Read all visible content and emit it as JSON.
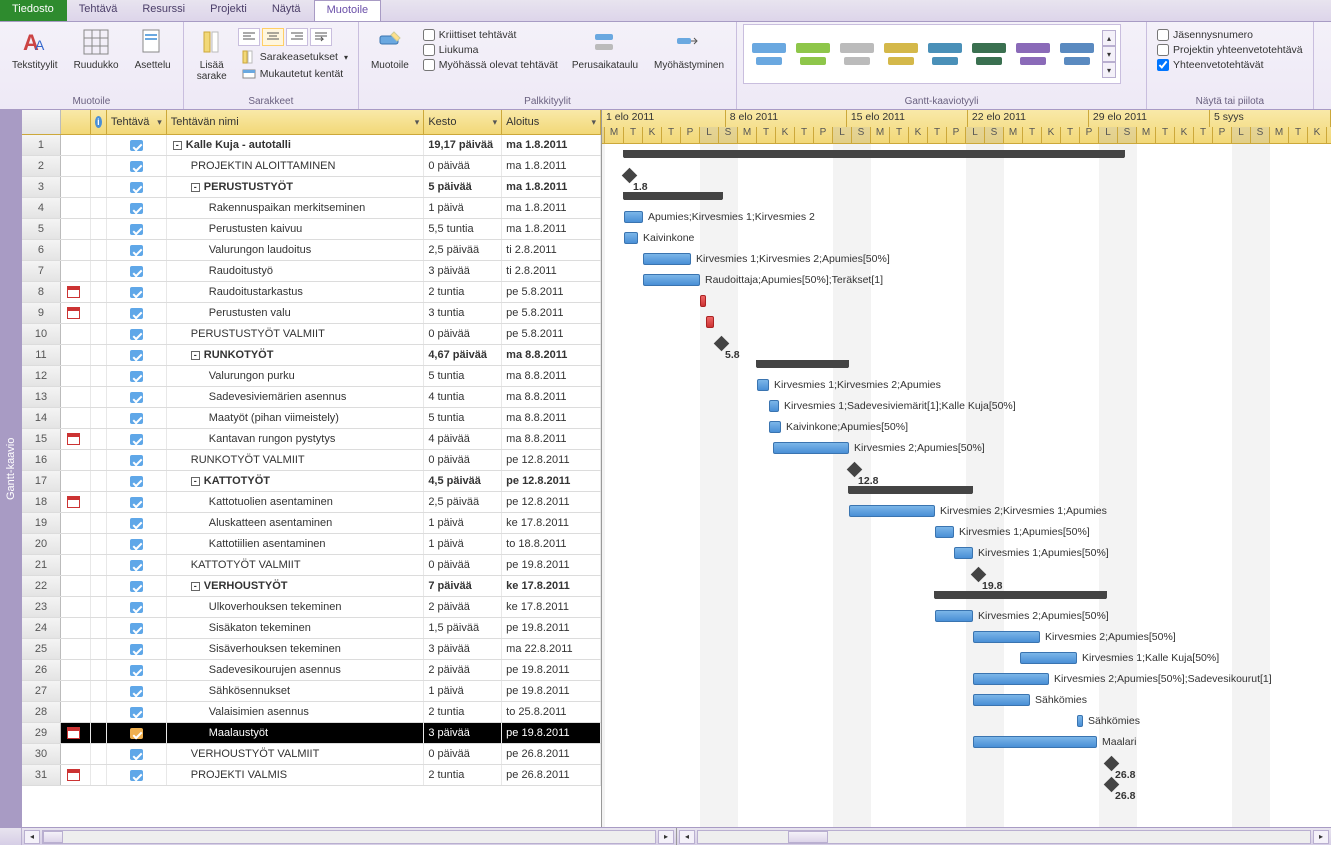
{
  "tabs": {
    "file": "Tiedosto",
    "task": "Tehtävä",
    "resource": "Resurssi",
    "project": "Projekti",
    "view": "Näytä",
    "format": "Muotoile"
  },
  "ribbon": {
    "muotoile_group": "Muotoile",
    "columns_group": "Sarakkeet",
    "bar_group": "Palkkityylit",
    "gantt_group": "Gantt-kaaviotyyli",
    "show_group": "Näytä tai piilota",
    "tekstityylit": "Tekstityylit",
    "ruudukko": "Ruudukko",
    "asettelu": "Asettelu",
    "lisaa_sarake": "Lisää\nsarake",
    "sarakeasetukset": "Sarakeasetukset",
    "mukautetut": "Mukautetut kentät",
    "muotoile": "Muotoile",
    "kriittiset": "Kriittiset tehtävät",
    "liukuma": "Liukuma",
    "myoh_tehtavat": "Myöhässä olevat tehtävät",
    "perusaikataulu": "Perusaikataulu",
    "myohastyminen": "Myöhästyminen",
    "jasennys": "Jäsennysnumero",
    "projektin_yhteenveto": "Projektin yhteenvetotehtävä",
    "yhteenveto": "Yhteenvetotehtävät"
  },
  "columns": {
    "info": "ⓘ",
    "tehtava": "Tehtävä",
    "nimi": "Tehtävän nimi",
    "kesto": "Kesto",
    "aloitus": "Aloitus"
  },
  "colwidths": {
    "rownum": 39,
    "ind": 30,
    "info": 16,
    "tehtava": 60,
    "nimi": 258,
    "kesto": 78,
    "aloitus": 99
  },
  "timeline": {
    "weeks": [
      "1 elo 2011",
      "8 elo 2011",
      "15 elo 2011",
      "22 elo 2011",
      "29 elo 2011",
      "5 syys"
    ],
    "days": [
      "S",
      "M",
      "T",
      "K",
      "T",
      "P",
      "L"
    ]
  },
  "side_label": "Gantt-kaavio",
  "tasks": [
    {
      "n": 1,
      "lvl": 0,
      "bold": true,
      "outline": "-",
      "name": "Kalle Kuja - autotalli",
      "dur": "19,17 päivää",
      "start": "ma 1.8.2011",
      "type": "summary",
      "gstart": 22,
      "glen": 500
    },
    {
      "n": 2,
      "lvl": 1,
      "name": "PROJEKTIN ALOITTAMINEN",
      "dur": "0 päivää",
      "start": "ma 1.8.2011",
      "type": "milestone",
      "gstart": 22,
      "label": "1.8"
    },
    {
      "n": 3,
      "lvl": 1,
      "bold": true,
      "outline": "-",
      "name": "PERUSTUSTYÖT",
      "dur": "5 päivää",
      "start": "ma 1.8.2011",
      "type": "summary",
      "gstart": 22,
      "glen": 98
    },
    {
      "n": 4,
      "lvl": 2,
      "name": "Rakennuspaikan merkitseminen",
      "dur": "1 päivä",
      "start": "ma 1.8.2011",
      "type": "bar",
      "gstart": 22,
      "glen": 19,
      "label": "Apumies;Kirvesmies 1;Kirvesmies 2"
    },
    {
      "n": 5,
      "lvl": 2,
      "name": "Perustusten kaivuu",
      "dur": "5,5 tuntia",
      "start": "ma 1.8.2011",
      "type": "bar",
      "gstart": 22,
      "glen": 14,
      "label": "Kaivinkone"
    },
    {
      "n": 6,
      "lvl": 2,
      "name": "Valurungon laudoitus",
      "dur": "2,5 päivää",
      "start": "ti 2.8.2011",
      "type": "bar",
      "gstart": 41,
      "glen": 48,
      "label": "Kirvesmies 1;Kirvesmies 2;Apumies[50%]"
    },
    {
      "n": 7,
      "lvl": 2,
      "name": "Raudoitustyö",
      "dur": "3 päivää",
      "start": "ti 2.8.2011",
      "type": "bar",
      "gstart": 41,
      "glen": 57,
      "label": "Raudoittaja;Apumies[50%];Teräkset[1]"
    },
    {
      "n": 8,
      "lvl": 2,
      "cal": true,
      "name": "Raudoitustarkastus",
      "dur": "2 tuntia",
      "start": "pe 5.8.2011",
      "type": "bar",
      "gstart": 98,
      "glen": 6,
      "red": true
    },
    {
      "n": 9,
      "lvl": 2,
      "cal": true,
      "name": "Perustusten valu",
      "dur": "3 tuntia",
      "start": "pe 5.8.2011",
      "type": "bar",
      "gstart": 104,
      "glen": 8,
      "red": true
    },
    {
      "n": 10,
      "lvl": 1,
      "name": "PERUSTUSTYÖT VALMIIT",
      "dur": "0 päivää",
      "start": "pe 5.8.2011",
      "type": "milestone",
      "gstart": 114,
      "label": "5.8"
    },
    {
      "n": 11,
      "lvl": 1,
      "bold": true,
      "outline": "-",
      "name": "RUNKOTYÖT",
      "dur": "4,67 päivää",
      "start": "ma 8.8.2011",
      "type": "summary",
      "gstart": 155,
      "glen": 91
    },
    {
      "n": 12,
      "lvl": 2,
      "name": "Valurungon purku",
      "dur": "5 tuntia",
      "start": "ma 8.8.2011",
      "type": "bar",
      "gstart": 155,
      "glen": 12,
      "label": "Kirvesmies 1;Kirvesmies 2;Apumies"
    },
    {
      "n": 13,
      "lvl": 2,
      "name": "Sadevesiviemärien asennus",
      "dur": "4 tuntia",
      "start": "ma 8.8.2011",
      "type": "bar",
      "gstart": 167,
      "glen": 10,
      "label": "Kirvesmies 1;Sadevesiviemärit[1];Kalle Kuja[50%]"
    },
    {
      "n": 14,
      "lvl": 2,
      "name": "Maatyöt (pihan viimeistely)",
      "dur": "5 tuntia",
      "start": "ma 8.8.2011",
      "type": "bar",
      "gstart": 167,
      "glen": 12,
      "label": "Kaivinkone;Apumies[50%]"
    },
    {
      "n": 15,
      "lvl": 2,
      "cal": true,
      "name": "Kantavan rungon pystytys",
      "dur": "4 päivää",
      "start": "ma 8.8.2011",
      "type": "bar",
      "gstart": 171,
      "glen": 76,
      "label": "Kirvesmies 2;Apumies[50%]"
    },
    {
      "n": 16,
      "lvl": 1,
      "name": "RUNKOTYÖT VALMIIT",
      "dur": "0 päivää",
      "start": "pe 12.8.2011",
      "type": "milestone",
      "gstart": 247,
      "label": "12.8"
    },
    {
      "n": 17,
      "lvl": 1,
      "bold": true,
      "outline": "-",
      "name": "KATTOTYÖT",
      "dur": "4,5 päivää",
      "start": "pe 12.8.2011",
      "type": "summary",
      "gstart": 247,
      "glen": 123
    },
    {
      "n": 18,
      "lvl": 2,
      "cal": true,
      "name": "Kattotuolien asentaminen",
      "dur": "2,5 päivää",
      "start": "pe 12.8.2011",
      "type": "bar",
      "gstart": 247,
      "glen": 86,
      "label": "Kirvesmies 2;Kirvesmies 1;Apumies"
    },
    {
      "n": 19,
      "lvl": 2,
      "name": "Aluskatteen asentaminen",
      "dur": "1 päivä",
      "start": "ke 17.8.2011",
      "type": "bar",
      "gstart": 333,
      "glen": 19,
      "label": "Kirvesmies 1;Apumies[50%]"
    },
    {
      "n": 20,
      "lvl": 2,
      "name": "Kattotiilien asentaminen",
      "dur": "1 päivä",
      "start": "to 18.8.2011",
      "type": "bar",
      "gstart": 352,
      "glen": 19,
      "label": "Kirvesmies 1;Apumies[50%]"
    },
    {
      "n": 21,
      "lvl": 1,
      "name": "KATTOTYÖT VALMIIT",
      "dur": "0 päivää",
      "start": "pe 19.8.2011",
      "type": "milestone",
      "gstart": 371,
      "label": "19.8"
    },
    {
      "n": 22,
      "lvl": 1,
      "bold": true,
      "outline": "-",
      "name": "VERHOUSTYÖT",
      "dur": "7 päivää",
      "start": "ke 17.8.2011",
      "type": "summary",
      "gstart": 333,
      "glen": 171
    },
    {
      "n": 23,
      "lvl": 2,
      "name": "Ulkoverhouksen tekeminen",
      "dur": "2 päivää",
      "start": "ke 17.8.2011",
      "type": "bar",
      "gstart": 333,
      "glen": 38,
      "label": "Kirvesmies 2;Apumies[50%]"
    },
    {
      "n": 24,
      "lvl": 2,
      "name": "Sisäkaton tekeminen",
      "dur": "1,5 päivää",
      "start": "pe 19.8.2011",
      "type": "bar",
      "gstart": 371,
      "glen": 67,
      "label": "Kirvesmies 2;Apumies[50%]"
    },
    {
      "n": 25,
      "lvl": 2,
      "name": "Sisäverhouksen tekeminen",
      "dur": "3 päivää",
      "start": "ma 22.8.2011",
      "type": "bar",
      "gstart": 418,
      "glen": 57,
      "label": "Kirvesmies 1;Kalle Kuja[50%]"
    },
    {
      "n": 26,
      "lvl": 2,
      "name": "Sadevesikourujen asennus",
      "dur": "2 päivää",
      "start": "pe 19.8.2011",
      "type": "bar",
      "gstart": 371,
      "glen": 76,
      "label": "Kirvesmies 2;Apumies[50%];Sadevesikourut[1]"
    },
    {
      "n": 27,
      "lvl": 2,
      "name": "Sähkösennukset",
      "dur": "1 päivä",
      "start": "pe 19.8.2011",
      "type": "bar",
      "gstart": 371,
      "glen": 57,
      "label": "Sähkömies"
    },
    {
      "n": 28,
      "lvl": 2,
      "name": "Valaisimien asennus",
      "dur": "2 tuntia",
      "start": "to 25.8.2011",
      "type": "bar",
      "gstart": 475,
      "glen": 6,
      "label": "Sähkömies"
    },
    {
      "n": 29,
      "lvl": 2,
      "cal": true,
      "sel": true,
      "name": "Maalaustyöt",
      "dur": "3 päivää",
      "start": "pe 19.8.2011",
      "type": "bar",
      "gstart": 371,
      "glen": 124,
      "label": "Maalari"
    },
    {
      "n": 30,
      "lvl": 1,
      "name": "VERHOUSTYÖT VALMIIT",
      "dur": "0 päivää",
      "start": "pe 26.8.2011",
      "type": "milestone",
      "gstart": 504,
      "label": "26.8"
    },
    {
      "n": 31,
      "lvl": 1,
      "cal": true,
      "name": "PROJEKTI VALMIS",
      "dur": "2 tuntia",
      "start": "pe 26.8.2011",
      "type": "milestone",
      "gstart": 504,
      "label": "26.8"
    }
  ]
}
